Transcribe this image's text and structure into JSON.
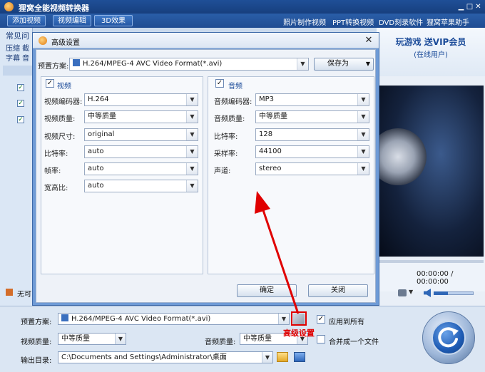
{
  "app": {
    "title": "狸窝全能视频转换器"
  },
  "toolbar": {
    "add_video": "添加视频",
    "edit_video": "视频编辑",
    "effects_3d": "3D效果",
    "links": [
      "照片制作视频",
      "PPT转换视频",
      "DVD刻录软件",
      "狸窝苹果助手"
    ]
  },
  "left": {
    "tab_label": "常见问",
    "row1": "压缩 截",
    "row2": "字幕 音",
    "footer": "无可"
  },
  "promo": {
    "line1": "玩游戏  送VIP会员",
    "line2": "(在线用户)"
  },
  "player": {
    "time": "00:00:00 / 00:00:00"
  },
  "dialog": {
    "title": "高级设置",
    "preset_label": "预置方案:",
    "preset_value": "H.264/MPEG-4 AVC Video Format(*.avi)",
    "save_as": "保存为",
    "video": {
      "heading": "视频",
      "fields": [
        {
          "label": "视频编码器:",
          "value": "H.264"
        },
        {
          "label": "视频质量:",
          "value": "中等质量"
        },
        {
          "label": "视频尺寸:",
          "value": "original"
        },
        {
          "label": "比特率:",
          "value": "auto"
        },
        {
          "label": "帧率:",
          "value": "auto"
        },
        {
          "label": "宽高比:",
          "value": "auto"
        }
      ]
    },
    "audio": {
      "heading": "音频",
      "fields": [
        {
          "label": "音频编码器:",
          "value": "MP3"
        },
        {
          "label": "音频质量:",
          "value": "中等质量"
        },
        {
          "label": "比特率:",
          "value": "128"
        },
        {
          "label": "采样率:",
          "value": "44100"
        },
        {
          "label": "声道:",
          "value": "stereo"
        }
      ]
    },
    "ok": "确定",
    "close": "关闭"
  },
  "bottom": {
    "preset_label": "预置方案:",
    "preset_value": "H.264/MPEG-4 AVC Video Format(*.avi)",
    "apply_all": "应用到所有",
    "video_quality_label": "视频质量:",
    "video_quality_value": "中等质量",
    "audio_quality_label": "音频质量:",
    "audio_quality_value": "中等质量",
    "merge": "合并成一个文件",
    "output_label": "输出目录:",
    "output_value": "C:\\Documents and Settings\\Administrator\\桌面"
  },
  "annotation": {
    "label": "高级设置",
    "color": "#e00000"
  }
}
